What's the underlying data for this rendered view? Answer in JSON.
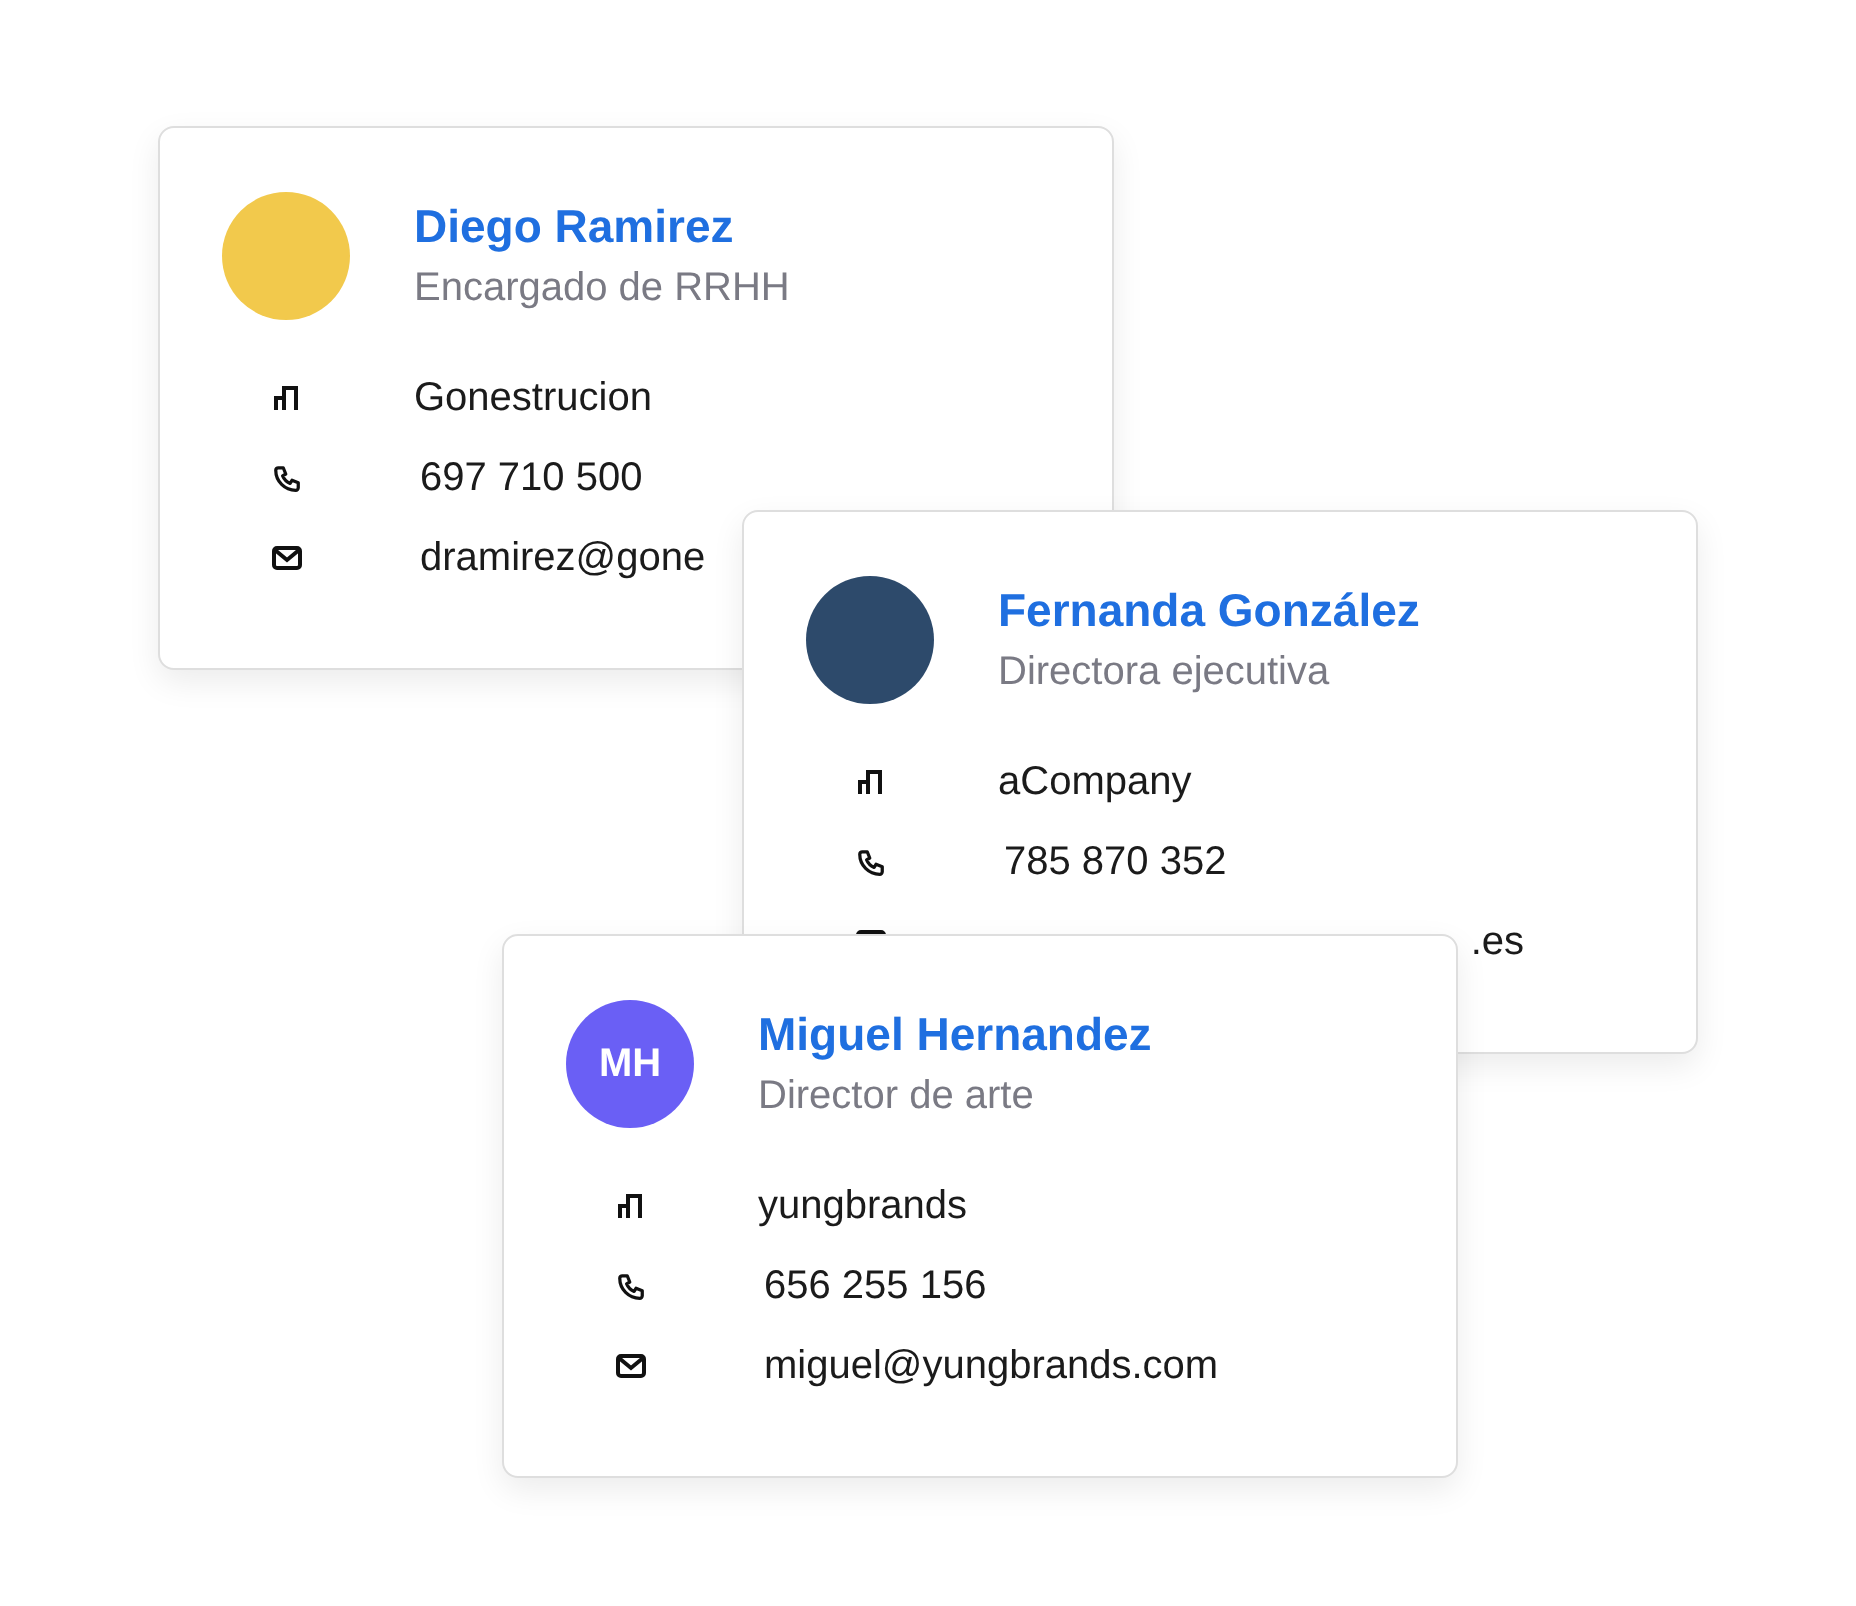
{
  "cards": [
    {
      "name": "Diego Ramirez",
      "role": "Encargado de RRHH",
      "avatar": {
        "kind": "photo",
        "color": "#f2c94c"
      },
      "rows": [
        {
          "kind": "company",
          "text": "Gonestrucion",
          "clipped_start": false
        },
        {
          "kind": "phone",
          "text": "697 710 500",
          "clipped_start": false
        },
        {
          "kind": "email",
          "text": "dramirez@gone",
          "clipped_start": false
        }
      ]
    },
    {
      "name": "Fernanda González",
      "role": "Directora ejecutiva",
      "avatar": {
        "kind": "photo",
        "color": "#2d4a6b"
      },
      "rows": [
        {
          "kind": "company",
          "text": "aCompany",
          "clipped_start": false
        },
        {
          "kind": "phone",
          "text": "785 870 352",
          "clipped_start": false
        },
        {
          "kind": "email",
          "text": ".es",
          "clipped_start": true
        }
      ]
    },
    {
      "name": "Miguel Hernandez",
      "role": "Director de arte",
      "avatar": {
        "kind": "initials",
        "text": "MH",
        "color": "#6a5ff5"
      },
      "rows": [
        {
          "kind": "company",
          "text": "yungbrands",
          "clipped_start": false
        },
        {
          "kind": "phone",
          "text": "656 255 156",
          "clipped_start": false
        },
        {
          "kind": "email",
          "text": "miguel@yungbrands.com",
          "clipped_start": false
        }
      ]
    }
  ]
}
